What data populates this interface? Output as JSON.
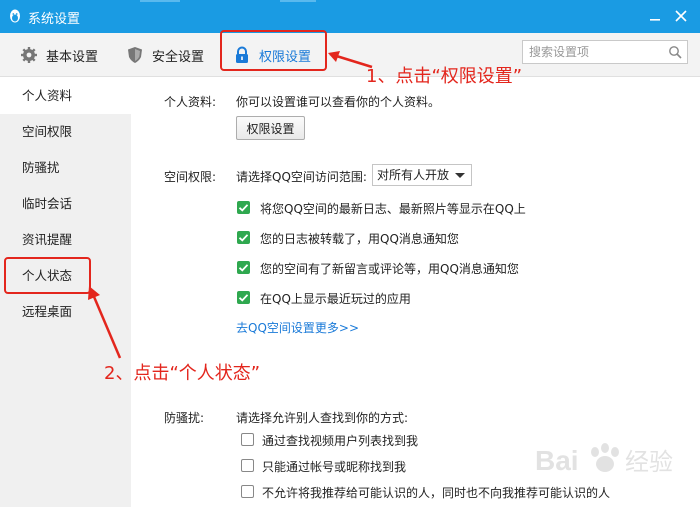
{
  "window": {
    "title": "系统设置"
  },
  "tabs": [
    {
      "label": "基本设置",
      "icon": "gear-icon"
    },
    {
      "label": "安全设置",
      "icon": "shield-icon"
    },
    {
      "label": "权限设置",
      "icon": "lock-icon",
      "active": true
    }
  ],
  "search": {
    "placeholder": "搜索设置项"
  },
  "sidebar": {
    "items": [
      {
        "label": "个人资料",
        "active": true
      },
      {
        "label": "空间权限"
      },
      {
        "label": "防骚扰"
      },
      {
        "label": "临时会话"
      },
      {
        "label": "资讯提醒"
      },
      {
        "label": "个人状态"
      },
      {
        "label": "远程桌面"
      }
    ]
  },
  "profile": {
    "label": "个人资料:",
    "desc": "你可以设置谁可以查看你的个人资料。",
    "button": "权限设置"
  },
  "space": {
    "label": "空间权限:",
    "prompt": "请选择QQ空间访问范围:",
    "select_value": "对所有人开放",
    "checks": [
      {
        "label": "将您QQ空间的最新日志、最新照片等显示在QQ上",
        "checked": true
      },
      {
        "label": "您的日志被转载了，用QQ消息通知您",
        "checked": true
      },
      {
        "label": "您的空间有了新留言或评论等，用QQ消息通知您",
        "checked": true
      },
      {
        "label": "在QQ上显示最近玩过的应用",
        "checked": true
      }
    ],
    "link": "去QQ空间设置更多>>"
  },
  "harass": {
    "label": "防骚扰:",
    "prompt": "请选择允许别人查找到你的方式:",
    "checks": [
      {
        "label": "通过查找视频用户列表找到我",
        "checked": false
      },
      {
        "label": "只能通过帐号或昵称找到我",
        "checked": false
      },
      {
        "label": "不允许将我推荐给可能认识的人，同时也不向我推荐可能认识的人",
        "checked": false
      }
    ]
  },
  "annotations": {
    "step1": "1、点击“权限设置”",
    "step2": "2、点击“个人状态”",
    "color": "#e3261d"
  },
  "watermark": {
    "text": "Bai经验"
  },
  "colors": {
    "titlebar": "#1a9be3",
    "accent": "#1a7ad8",
    "check": "#2fa84f"
  }
}
